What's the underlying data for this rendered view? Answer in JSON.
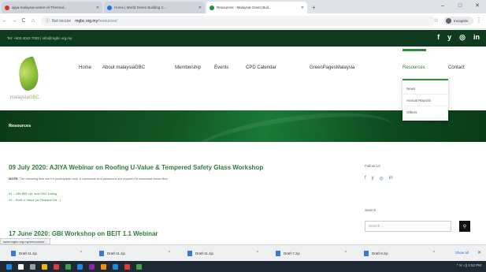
{
  "browser": {
    "tabs": [
      {
        "label": "ajiya-malaysia-centre-of-Thermal...",
        "color": "#d93025",
        "active": false
      },
      {
        "label": "Home | World Green Building C...",
        "color": "#1a73e8",
        "active": false
      },
      {
        "label": "Resources - Malaysia Green Buil...",
        "color": "#2f8b3e",
        "active": true
      }
    ],
    "new_tab": "+",
    "win_controls": [
      "–",
      "□",
      "✕"
    ],
    "nav": [
      "←",
      "→",
      "C",
      "⌂"
    ],
    "security": "Not secure",
    "url_host": "mgbc.org.my",
    "url_path": "/resources/",
    "star": "☆",
    "profile_label": "Incognito",
    "menu": "⋮"
  },
  "site": {
    "contact": "Tel: +603 4043 7003 | info@mgbc.org.my",
    "social": [
      "f",
      "y",
      "◎",
      "in"
    ],
    "logo": {
      "prefix": "malaysia",
      "suffix": "GBC"
    },
    "nav": [
      {
        "label": "Home",
        "active": false
      },
      {
        "label": "About malaysiaGBC",
        "active": false
      },
      {
        "label": "Membership",
        "active": false
      },
      {
        "label": "Events",
        "active": false
      },
      {
        "label": "CPD Calendar",
        "active": false
      },
      {
        "label": "GreenPagesMalaysia",
        "active": false
      },
      {
        "label": "Resources",
        "active": true
      },
      {
        "label": "Contact",
        "active": false
      }
    ],
    "dropdown": [
      "News",
      "Annual Reports",
      "Others"
    ],
    "banner_title": "Resources"
  },
  "posts": [
    {
      "title": "09 July 2020: AJIYA Webinar on Roofing U-Value & Tempered Safety Glass Workshop",
      "note_label": "NOTE:",
      "note": "The following files are for participants only. A username and password are required to download these files.",
      "downloads": [
        "01 – GBI BEI Ltd. and GBC Listing",
        "02 – Roof U-Value (w/ Richard Ooi...)"
      ]
    },
    {
      "title": "17 June 2020: GBI Workshop on BEIT 1.1 Webinar"
    }
  ],
  "sidebar": {
    "follow_label": "Follow Us",
    "social": [
      "f",
      "y",
      "◎",
      "in"
    ],
    "search_label": "Search",
    "search_placeholder": "Search ...",
    "search_icon": "⚲"
  },
  "status_url": "www.mgbc.org.my/resources/...",
  "downloads_bar": {
    "items": [
      "Draft-11.zip",
      "Draft-11.zip",
      "Draft-11.zip",
      "Draft-7.zip",
      "Draft-9.zip"
    ],
    "show_all": "Show all",
    "close": "✕"
  },
  "taskbar": {
    "icons": [
      "#1e88e5",
      "#ffffff",
      "#9e9e9e",
      "#f4b400",
      "#e53935",
      "#43a047",
      "#1e88e5",
      "#8e24aa",
      "#fb8c00",
      "#1e88e5",
      "#e53935",
      "#43a047"
    ],
    "tray": "^ ✉ ◁) 1:52 PM"
  }
}
